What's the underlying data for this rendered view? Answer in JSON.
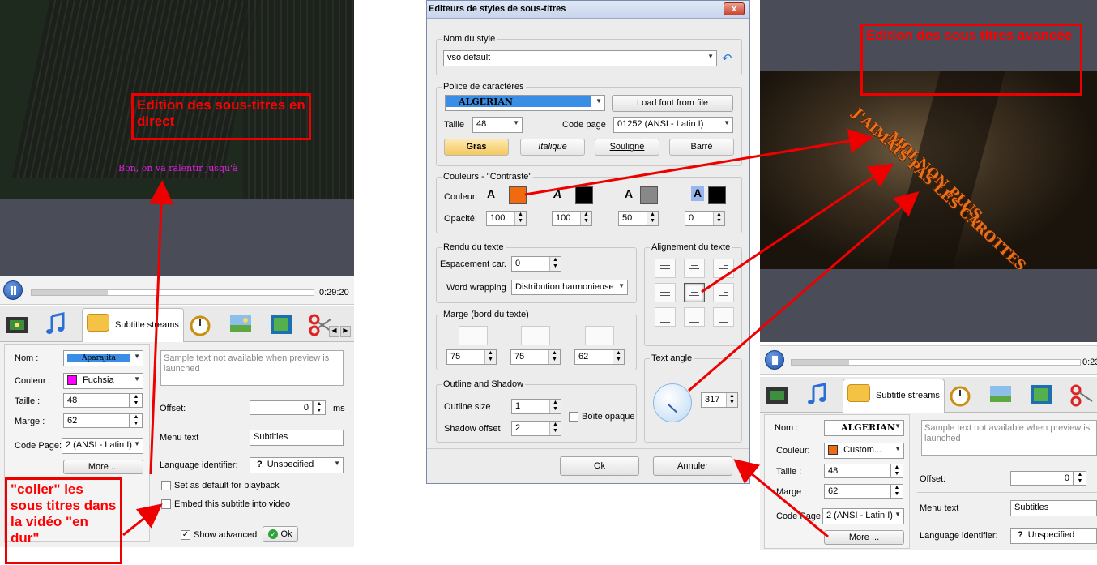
{
  "left": {
    "video_subtitle": "Bon, on va ralentir jusqu'à",
    "time": "0:29:20",
    "progress": 0.27,
    "tab_label": "Subtitle streams",
    "nom_label": "Nom :",
    "nom_value": "Aparajita",
    "couleur_label": "Couleur :",
    "couleur_value": "Fuchsia",
    "couleur_hex": "#ff00ff",
    "taille_label": "Taille :",
    "taille_value": "48",
    "marge_label": "Marge :",
    "marge_value": "62",
    "codepage_label": "Code Page:",
    "codepage_value": "2 (ANSI - Latin I)",
    "more_label": "More ...",
    "preview_text": "Sample text not available when preview is launched",
    "offset_label": "Offset:",
    "offset_value": "0",
    "offset_unit": "ms",
    "menutext_label": "Menu text",
    "menutext_value": "Subtitles",
    "langid_label": "Language identifier:",
    "langid_value": "Unspecified",
    "default_label": "Set as default for playback",
    "embed_label": "Embed this subtitle into video",
    "show_adv_label": "Show advanced",
    "ok_label": "Ok"
  },
  "callouts": {
    "direct": "Edition des sous-titres en direct",
    "coller": "\"coller\" les sous titres dans la vidéo \"en dur\"",
    "avancee": "Edition des sous titres avancée"
  },
  "dialog": {
    "title": "Editeurs de styles de sous-titres",
    "close": "x",
    "style_group": "Nom du style",
    "style_value": "vso default",
    "font_group": "Police de caractères",
    "font_value": "ALGERIAN",
    "load_font": "Load font from file",
    "taille_label": "Taille",
    "taille_value": "48",
    "codepage_label": "Code page",
    "codepage_value": "01252 (ANSI - Latin I)",
    "bold": "Gras",
    "italic": "Italique",
    "underline": "Souligné",
    "strike": "Barré",
    "colors_group": "Couleurs - \"Contraste\"",
    "couleur_label": "Couleur:",
    "opacite_label": "Opacité:",
    "opacities": [
      "100",
      "100",
      "50",
      "0"
    ],
    "swatch_colors": [
      "#f06a0f",
      "#000000",
      "#888888",
      "#000000"
    ],
    "rendu_group": "Rendu du texte",
    "espacement_label": "Espacement car.",
    "espacement_value": "0",
    "wrap_label": "Word wrapping",
    "wrap_value": "Distribution harmonieuse",
    "marge_group": "Marge (bord du texte)",
    "margins": [
      "75",
      "75",
      "62"
    ],
    "outline_group": "Outline  and Shadow",
    "outline_label": "Outline size",
    "outline_value": "1",
    "shadow_label": "Shadow offset",
    "shadow_value": "2",
    "opaque_label": "Boîte opaque",
    "align_group": "Alignement du texte",
    "angle_group": "Text angle",
    "angle_value": "317",
    "ok": "Ok",
    "cancel": "Annuler"
  },
  "right": {
    "sub_line1": "MOI NON PLUS,",
    "sub_line2": "J'AIMAIS PAS LES CAROTTES.",
    "time": "0:23",
    "progress": 0.2,
    "tab_label": "Subtitle streams",
    "nom_label": "Nom :",
    "nom_value": "ALGERIAN",
    "couleur_label": "Couleur:",
    "couleur_value": "Custom...",
    "couleur_hex": "#f06a0f",
    "taille_label": "Taille :",
    "taille_value": "48",
    "marge_label": "Marge :",
    "marge_value": "62",
    "codepage_label": "Code Page:",
    "codepage_value": "2 (ANSI - Latin I)",
    "more_label": "More ...",
    "preview_text": "Sample text not available when preview is launched",
    "offset_label": "Offset:",
    "offset_value": "0",
    "menutext_label": "Menu text",
    "menutext_value": "Subtitles",
    "langid_label": "Language identifier:",
    "langid_value": "Unspecified"
  }
}
